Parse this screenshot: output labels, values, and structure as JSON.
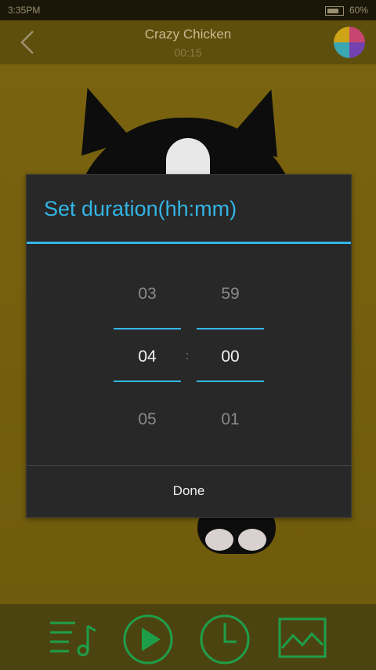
{
  "status": {
    "time": "3:35PM",
    "battery": "60%"
  },
  "header": {
    "title": "Crazy Chicken",
    "elapsed": "00:15"
  },
  "dialog": {
    "title": "Set duration(hh:mm)",
    "hours": {
      "prev": "03",
      "current": "04",
      "next": "05"
    },
    "minutes": {
      "prev": "59",
      "current": "00",
      "next": "01"
    },
    "separator": ":",
    "done_label": "Done"
  },
  "colors": {
    "accent": "#33b5e5",
    "icon_green": "#1f9e4a",
    "dialog_bg": "#282828"
  },
  "icons": [
    "back-icon",
    "app-icon",
    "playlist-icon",
    "play-icon",
    "timer-icon",
    "image-icon"
  ]
}
